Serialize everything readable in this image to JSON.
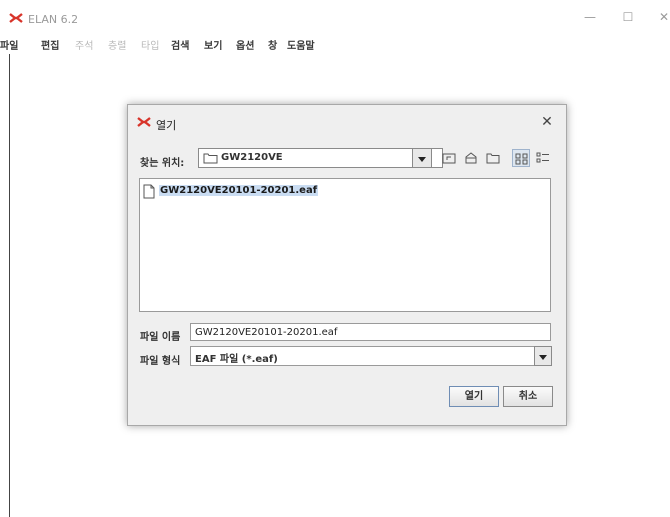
{
  "app": {
    "title": "ELAN 6.2",
    "logo_icon": "elan-logo-icon",
    "window_controls": {
      "minimize": "—",
      "maximize": "☐",
      "close": "✕"
    }
  },
  "menubar": {
    "items": [
      {
        "label": "파일",
        "enabled": true
      },
      {
        "label": "편집",
        "enabled": true
      },
      {
        "label": "주석",
        "enabled": false
      },
      {
        "label": "층렬",
        "enabled": false
      },
      {
        "label": "타입",
        "enabled": false
      },
      {
        "label": "검색",
        "enabled": true
      },
      {
        "label": "보기",
        "enabled": true
      },
      {
        "label": "옵션",
        "enabled": true
      },
      {
        "label": "창",
        "enabled": true
      },
      {
        "label": "도움말",
        "enabled": true
      }
    ]
  },
  "dialog": {
    "title": "열기",
    "close": "✕",
    "look_in_label": "찾는 위치:",
    "look_in_value": "GW2120VE",
    "toolbar_icons": [
      "up-folder-icon",
      "home-icon",
      "new-folder-icon",
      "list-view-icon",
      "details-view-icon"
    ],
    "files": [
      {
        "name": "GW2120VE20101-20201.eaf",
        "selected": true
      }
    ],
    "file_name_label": "파일 이름",
    "file_name_value": "GW2120VE20101-20201.eaf",
    "file_type_label": "파일 형식",
    "file_type_value": "EAF 파일 (*.eaf)",
    "open_button": "열기",
    "cancel_button": "취소"
  },
  "colors": {
    "selection": "#c9dcf2",
    "logo_red": "#d8342a",
    "dialog_bg": "#efefef"
  }
}
